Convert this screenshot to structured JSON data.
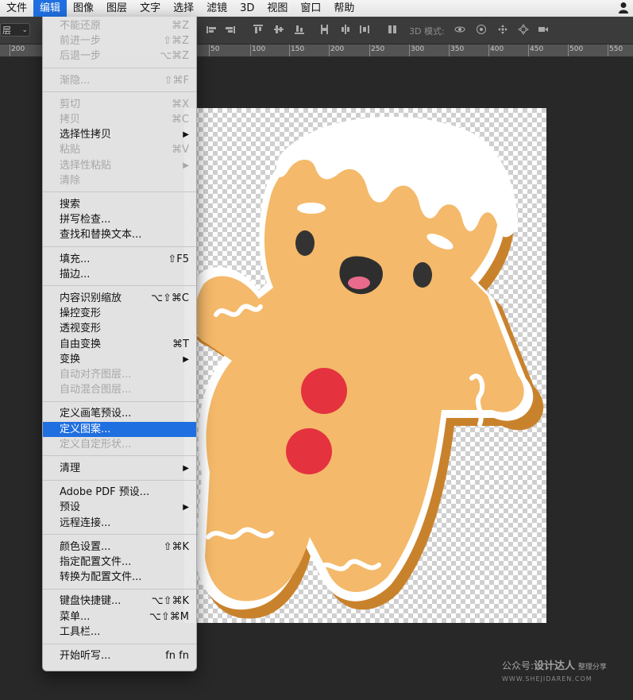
{
  "menubar": {
    "items": [
      {
        "label": "文件",
        "active": false
      },
      {
        "label": "编辑",
        "active": true
      },
      {
        "label": "图像",
        "active": false
      },
      {
        "label": "图层",
        "active": false
      },
      {
        "label": "文字",
        "active": false
      },
      {
        "label": "选择",
        "active": false
      },
      {
        "label": "滤镜",
        "active": false
      },
      {
        "label": "3D",
        "active": false
      },
      {
        "label": "视图",
        "active": false
      },
      {
        "label": "窗口",
        "active": false
      },
      {
        "label": "帮助",
        "active": false
      }
    ],
    "user_icon": "person-icon"
  },
  "options_bar": {
    "layer_select": "层",
    "mode_label": "3D 模式:",
    "icons": [
      "align-left-icon",
      "align-center-icon",
      "align-top-icon",
      "align-middle-icon",
      "align-bottom-icon",
      "distribute-icon",
      "distribute-icon",
      "distribute-icon",
      "distribute-icon",
      "orbit-icon",
      "roll-icon",
      "pan-icon",
      "slide-icon",
      "camera-icon"
    ]
  },
  "ruler": {
    "labels": [
      "200",
      "50",
      "100",
      "150",
      "200",
      "250",
      "300",
      "350",
      "400",
      "450",
      "500",
      "550"
    ]
  },
  "edit_menu": {
    "groups": [
      [
        {
          "label": "不能还原",
          "shortcut": "⌘Z",
          "enabled": false
        },
        {
          "label": "前进一步",
          "shortcut": "⇧⌘Z",
          "enabled": false
        },
        {
          "label": "后退一步",
          "shortcut": "⌥⌘Z",
          "enabled": false
        }
      ],
      [
        {
          "label": "渐隐...",
          "shortcut": "⇧⌘F",
          "enabled": false
        }
      ],
      [
        {
          "label": "剪切",
          "shortcut": "⌘X",
          "enabled": false
        },
        {
          "label": "拷贝",
          "shortcut": "⌘C",
          "enabled": false
        },
        {
          "label": "选择性拷贝",
          "shortcut": "▶",
          "enabled": true
        },
        {
          "label": "粘贴",
          "shortcut": "⌘V",
          "enabled": false
        },
        {
          "label": "选择性粘贴",
          "shortcut": "▶",
          "enabled": false
        },
        {
          "label": "清除",
          "shortcut": "",
          "enabled": false
        }
      ],
      [
        {
          "label": "搜索",
          "shortcut": "",
          "enabled": true
        },
        {
          "label": "拼写检查...",
          "shortcut": "",
          "enabled": true
        },
        {
          "label": "查找和替换文本...",
          "shortcut": "",
          "enabled": true
        }
      ],
      [
        {
          "label": "填充...",
          "shortcut": "⇧F5",
          "enabled": true
        },
        {
          "label": "描边...",
          "shortcut": "",
          "enabled": true
        }
      ],
      [
        {
          "label": "内容识别缩放",
          "shortcut": "⌥⇧⌘C",
          "enabled": true
        },
        {
          "label": "操控变形",
          "shortcut": "",
          "enabled": true
        },
        {
          "label": "透视变形",
          "shortcut": "",
          "enabled": true
        },
        {
          "label": "自由变换",
          "shortcut": "⌘T",
          "enabled": true
        },
        {
          "label": "变换",
          "shortcut": "▶",
          "enabled": true
        },
        {
          "label": "自动对齐图层...",
          "shortcut": "",
          "enabled": false
        },
        {
          "label": "自动混合图层...",
          "shortcut": "",
          "enabled": false
        }
      ],
      [
        {
          "label": "定义画笔预设...",
          "shortcut": "",
          "enabled": true
        },
        {
          "label": "定义图案...",
          "shortcut": "",
          "enabled": true,
          "highlighted": true
        },
        {
          "label": "定义自定形状...",
          "shortcut": "",
          "enabled": false
        }
      ],
      [
        {
          "label": "清理",
          "shortcut": "▶",
          "enabled": true
        }
      ],
      [
        {
          "label": "Adobe PDF 预设...",
          "shortcut": "",
          "enabled": true
        },
        {
          "label": "预设",
          "shortcut": "▶",
          "enabled": true
        },
        {
          "label": "远程连接...",
          "shortcut": "",
          "enabled": true
        }
      ],
      [
        {
          "label": "颜色设置...",
          "shortcut": "⇧⌘K",
          "enabled": true
        },
        {
          "label": "指定配置文件...",
          "shortcut": "",
          "enabled": true
        },
        {
          "label": "转换为配置文件...",
          "shortcut": "",
          "enabled": true
        }
      ],
      [
        {
          "label": "键盘快捷键...",
          "shortcut": "⌥⇧⌘K",
          "enabled": true
        },
        {
          "label": "菜单...",
          "shortcut": "⌥⇧⌘M",
          "enabled": true
        },
        {
          "label": "工具栏...",
          "shortcut": "",
          "enabled": true
        }
      ],
      [
        {
          "label": "开始听写...",
          "shortcut": "fn fn",
          "enabled": true
        }
      ]
    ]
  },
  "watermark": {
    "prefix": "公众号:",
    "name": "设计达人",
    "tag": "整理分享",
    "url": "WWW.SHEJIDAREN.COM"
  },
  "colors": {
    "menu_highlight": "#1f6fe0",
    "cookie": "#f4b96a",
    "cookie_shadow": "#c9822c",
    "icing": "#ffffff",
    "button": "#e4323f"
  }
}
